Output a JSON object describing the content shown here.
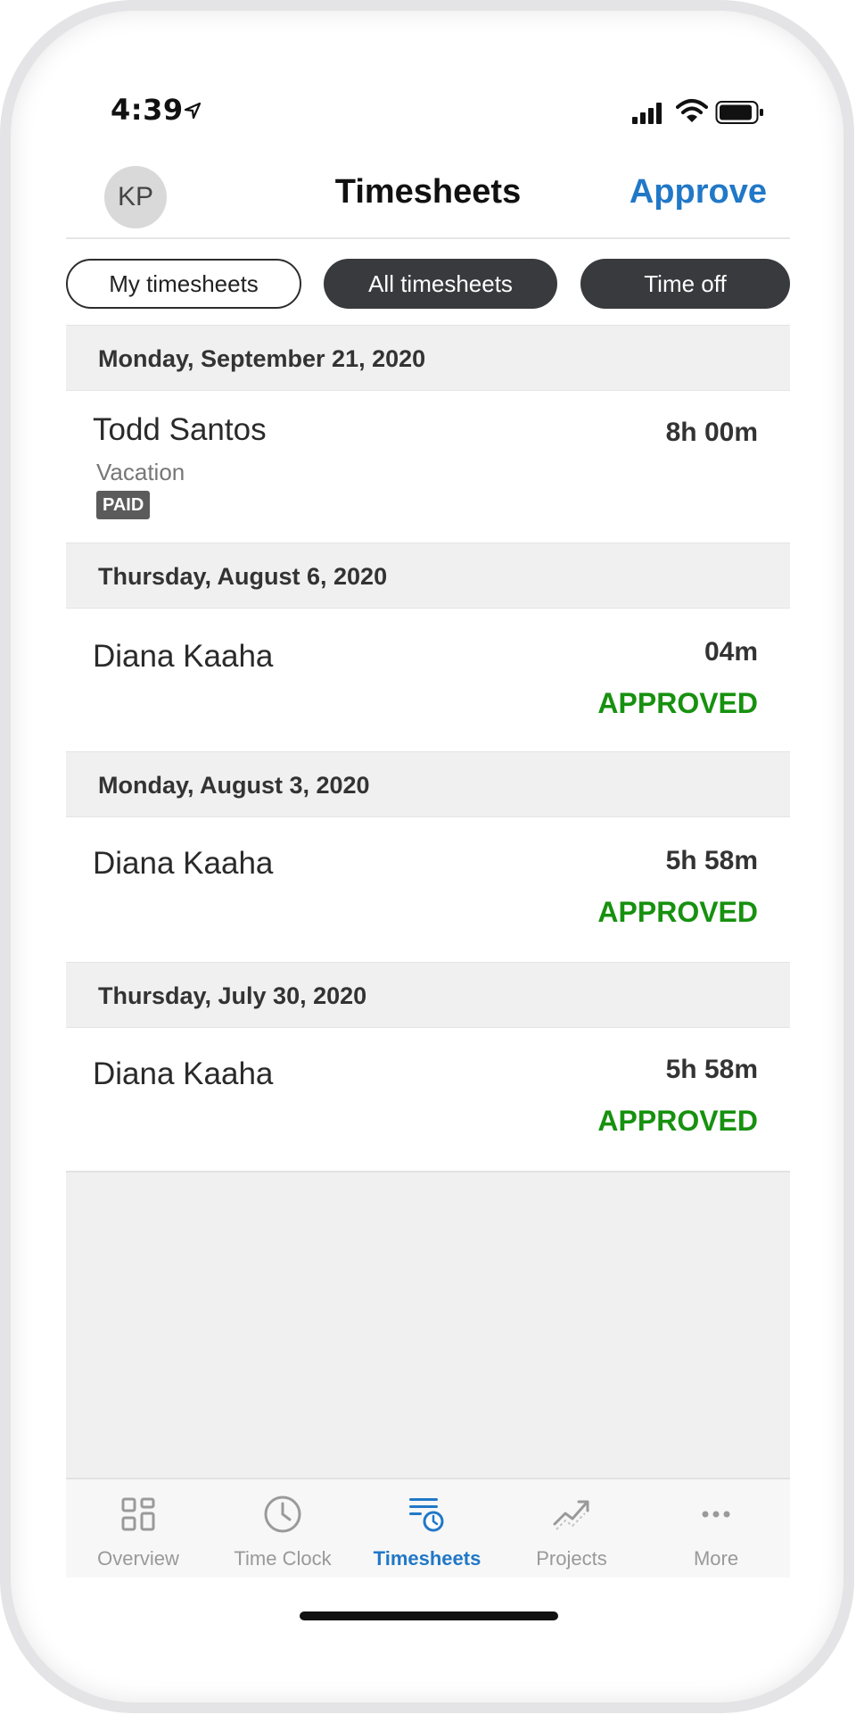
{
  "status_bar": {
    "time": "4:39"
  },
  "header": {
    "avatar_initials": "KP",
    "title": "Timesheets",
    "approve_label": "Approve"
  },
  "tabs": [
    {
      "label": "My timesheets",
      "selected": false
    },
    {
      "label": "All timesheets",
      "selected": true
    },
    {
      "label": "Time off",
      "selected": true
    }
  ],
  "groups": [
    {
      "date": "Monday, September 21, 2020",
      "entry": {
        "name": "Todd Santos",
        "subtitle": "Vacation",
        "badge": "PAID",
        "duration": "8h 00m",
        "status": ""
      }
    },
    {
      "date": "Thursday, August 6, 2020",
      "entry": {
        "name": "Diana Kaaha",
        "duration": "04m",
        "status": "APPROVED"
      }
    },
    {
      "date": "Monday, August 3, 2020",
      "entry": {
        "name": "Diana Kaaha",
        "duration": "5h 58m",
        "status": "APPROVED"
      }
    },
    {
      "date": "Thursday, July 30, 2020",
      "entry": {
        "name": "Diana Kaaha",
        "duration": "5h 58m",
        "status": "APPROVED"
      }
    }
  ],
  "bottom_nav": [
    {
      "label": "Overview",
      "icon": "grid-icon",
      "active": false
    },
    {
      "label": "Time Clock",
      "icon": "clock-icon",
      "active": false
    },
    {
      "label": "Timesheets",
      "icon": "timesheets-icon",
      "active": true
    },
    {
      "label": "Projects",
      "icon": "trend-icon",
      "active": false
    },
    {
      "label": "More",
      "icon": "more-icon",
      "active": false
    }
  ],
  "colors": {
    "accent": "#2178c7",
    "approved": "#17910f",
    "chip_dark": "#393a3d",
    "header_bg": "#f0f0f0"
  }
}
